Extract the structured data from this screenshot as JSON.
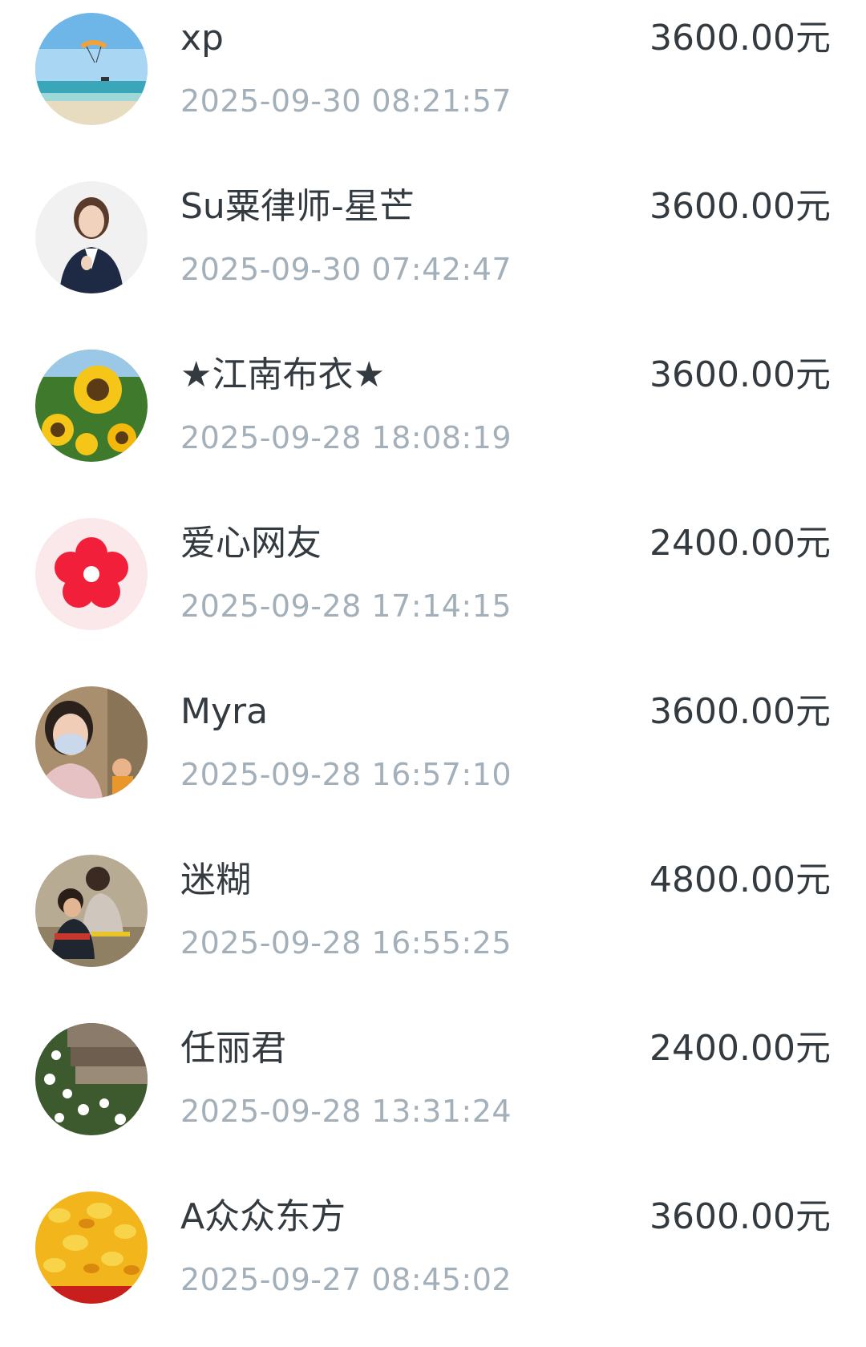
{
  "donations": [
    {
      "name": "xp",
      "time": "2025-09-30 08:21:57",
      "amount": "3600.00元",
      "avatar": "beach-paraglider-icon"
    },
    {
      "name": "Su粟律师-星芒",
      "time": "2025-09-30 07:42:47",
      "amount": "3600.00元",
      "avatar": "woman-in-suit-icon"
    },
    {
      "name": "★江南布衣★",
      "time": "2025-09-28 18:08:19",
      "amount": "3600.00元",
      "avatar": "sunflower-icon"
    },
    {
      "name": "爱心网友",
      "time": "2025-09-28 17:14:15",
      "amount": "2400.00元",
      "avatar": "red-flower-icon"
    },
    {
      "name": "Myra",
      "time": "2025-09-28 16:57:10",
      "amount": "3600.00元",
      "avatar": "masked-woman-icon"
    },
    {
      "name": "迷糊",
      "time": "2025-09-28 16:55:25",
      "amount": "4800.00元",
      "avatar": "family-outdoor-icon"
    },
    {
      "name": "任丽君",
      "time": "2025-09-28 13:31:24",
      "amount": "2400.00元",
      "avatar": "white-flowers-stone-icon"
    },
    {
      "name": "A众众东方",
      "time": "2025-09-27 08:45:02",
      "amount": "3600.00元",
      "avatar": "golden-leaves-icon"
    }
  ]
}
